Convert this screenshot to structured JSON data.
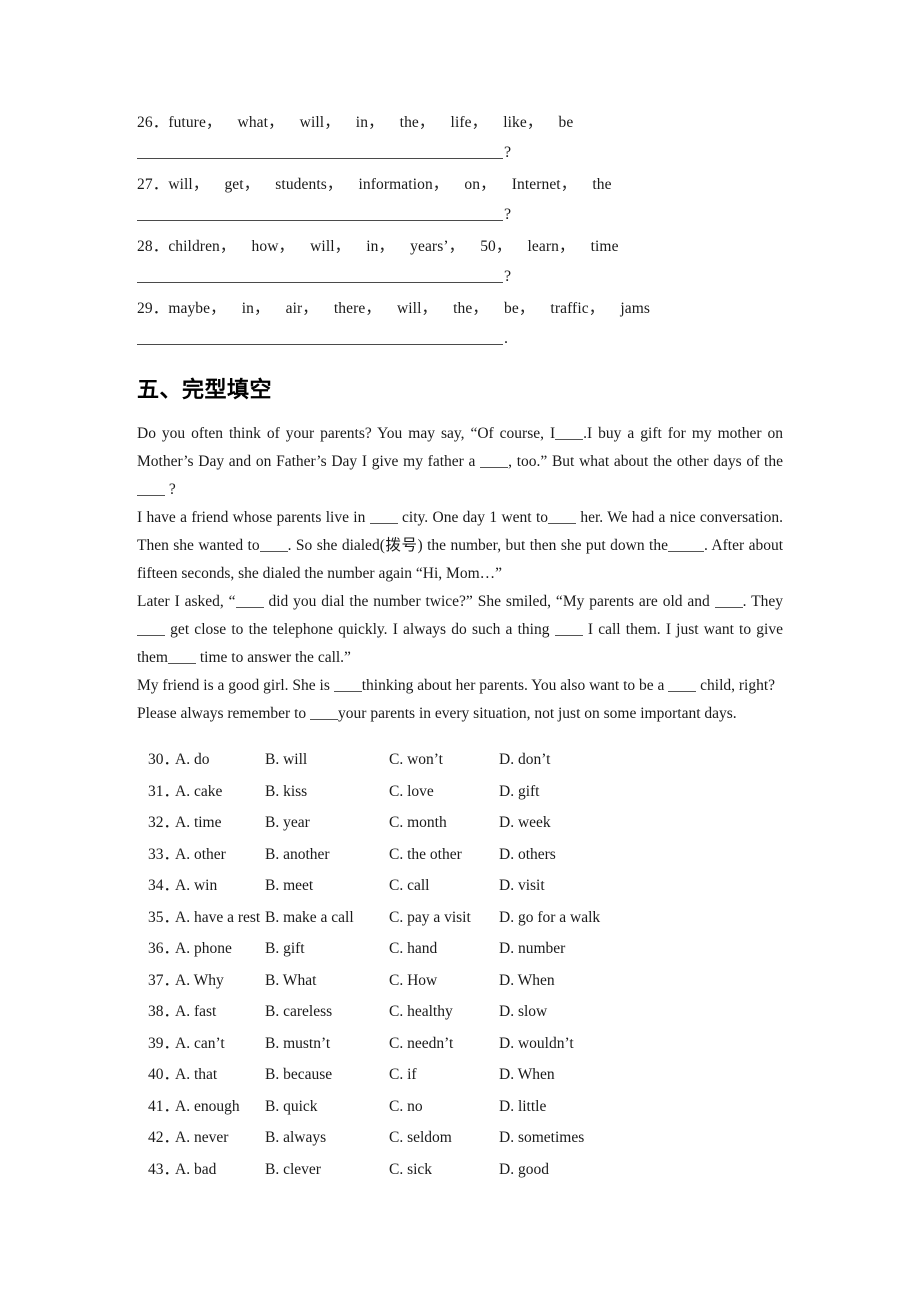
{
  "document": {
    "rearrange_items": [
      {
        "number": "26．",
        "words": [
          "future",
          "what",
          "will",
          "in",
          "the",
          "life",
          "like",
          "be"
        ],
        "separator": "，",
        "end_punctuation": "?"
      },
      {
        "number": "27．",
        "words": [
          "will",
          "get",
          "students",
          "information",
          "on",
          "Internet",
          "the"
        ],
        "separator": "，",
        "end_punctuation": "?"
      },
      {
        "number": "28．",
        "words": [
          "children",
          "how",
          "will",
          "in",
          "years’",
          "50",
          "learn",
          "time"
        ],
        "separator": "，",
        "end_punctuation": "?"
      },
      {
        "number": "29．",
        "words": [
          "maybe",
          "in",
          "air",
          "there",
          "will",
          "the",
          "be",
          "traffic",
          "jams"
        ],
        "separator": "，",
        "end_punctuation": "."
      }
    ],
    "section": {
      "heading": "五、完型填空"
    },
    "passage": {
      "paragraphs": [
        "Do you often think of your parents? You may say, “Of course, I____.I buy a gift for my mother on Mother’s Day and on Father’s Day I give my father a ____, too.” But what about the other days of the ____ ?",
        "I have a friend whose parents live in ____ city. One day 1 went to____ her. We had a nice conversation. Then she wanted to____. So she dialed(拨号) the number, but then she put down the_____. After about fifteen seconds, she dialed the number again “Hi, Mom…”",
        "Later I asked, “____ did you dial the number twice?” She smiled, “My parents are old and ____. They____ get close to the telephone quickly. I always do such a thing ____ I call them. I just want to give them____ time to answer the call.”",
        "My friend is a good girl. She is ____thinking about her parents. You also want to be a ____ child, right? Please always remember to ____your parents in every situation, not just on some important days."
      ]
    },
    "questions": [
      {
        "number": "30．",
        "a": "A. do",
        "b": "B. will",
        "c": "C. won’t",
        "d": "D. don’t"
      },
      {
        "number": "31．",
        "a": "A. cake",
        "b": "B. kiss",
        "c": "C. love",
        "d": "D. gift"
      },
      {
        "number": "32．",
        "a": "A. time",
        "b": "B. year",
        "c": "C. month",
        "d": "D. week"
      },
      {
        "number": "33．",
        "a": "A. other",
        "b": "B. another",
        "c": "C. the other",
        "d": "D. others"
      },
      {
        "number": "34．",
        "a": "A. win",
        "b": "B. meet",
        "c": "C. call",
        "d": "D. visit"
      },
      {
        "number": "35．",
        "a": "A. have a rest",
        "b": "B. make a call",
        "c": "C. pay a visit",
        "d": "D. go for a walk"
      },
      {
        "number": "36．",
        "a": "A. phone",
        "b": "B. gift",
        "c": "C. hand",
        "d": "D. number"
      },
      {
        "number": "37．",
        "a": "A. Why",
        "b": "B. What",
        "c": "C. How",
        "d": "D. When"
      },
      {
        "number": "38．",
        "a": "A. fast",
        "b": "B. careless",
        "c": "C. healthy",
        "d": "D. slow"
      },
      {
        "number": "39．",
        "a": "A. can’t",
        "b": "B. mustn’t",
        "c": "C. needn’t",
        "d": "D. wouldn’t"
      },
      {
        "number": "40．",
        "a": "A. that",
        "b": "B. because",
        "c": "C. if",
        "d": "D. When"
      },
      {
        "number": "41．",
        "a": "A. enough",
        "b": "B. quick",
        "c": "C. no",
        "d": "D. little"
      },
      {
        "number": "42．",
        "a": "A. never",
        "b": "B. always",
        "c": "C. seldom",
        "d": "D. sometimes"
      },
      {
        "number": "43．",
        "a": "A. bad",
        "b": "B. clever",
        "c": "C. sick",
        "d": "D. good"
      }
    ]
  }
}
